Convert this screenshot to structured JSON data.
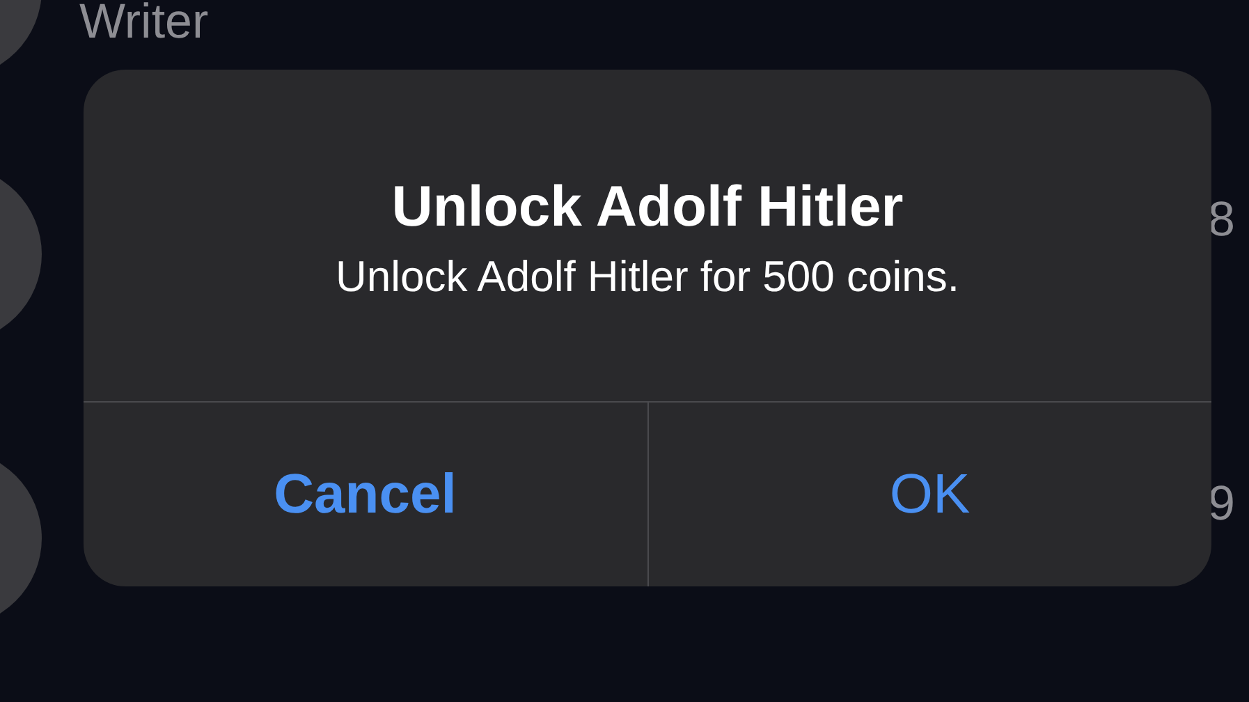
{
  "background_list": [
    {
      "subtitle": "Writer"
    },
    {
      "trailing": "8"
    },
    {
      "trailing": "9"
    }
  ],
  "alert": {
    "title": "Unlock Adolf Hitler",
    "message": "Unlock Adolf Hitler for 500 coins.",
    "buttons": [
      {
        "label": "Cancel",
        "kind": "cancel"
      },
      {
        "label": "OK",
        "kind": "default"
      }
    ]
  }
}
